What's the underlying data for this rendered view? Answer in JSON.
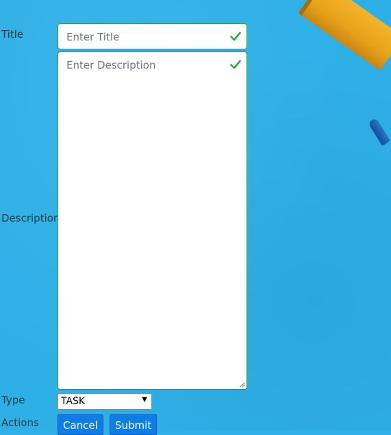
{
  "form": {
    "title": {
      "label": "Title",
      "placeholder": "Enter Title"
    },
    "description": {
      "label": "Description",
      "placeholder": "Enter Description"
    },
    "type": {
      "label": "Type",
      "selected": "TASK"
    },
    "actions": {
      "label": "Actions",
      "cancel": "Cancel",
      "submit": "Submit"
    }
  },
  "icons": {
    "valid": "checkmark-icon",
    "dropdown": "triangle-down-icon"
  },
  "colors": {
    "background": "#2eb0e7",
    "valid_border": "#2f9b4b",
    "valid_check": "#28a745",
    "button": "#0d7ee8"
  }
}
